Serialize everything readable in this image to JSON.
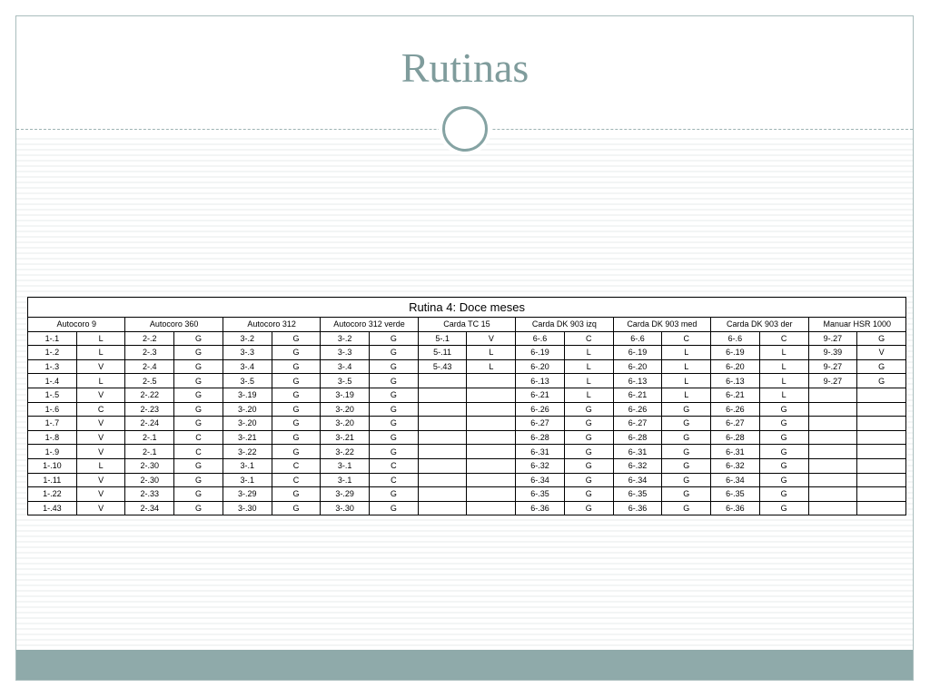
{
  "slide": {
    "title": "Rutinas"
  },
  "table": {
    "caption": "Rutina 4: Doce meses",
    "groups": [
      "Autocoro 9",
      "Autocoro 360",
      "Autocoro 312",
      "Autocoro 312 verde",
      "Carda TC 15",
      "Carda DK 903 izq",
      "Carda DK 903 med",
      "Carda DK 903 der",
      "Manuar HSR 1000"
    ],
    "rows": [
      [
        "1-.1",
        "L",
        "2-.2",
        "G",
        "3-.2",
        "G",
        "3-.2",
        "G",
        "5-.1",
        "V",
        "6-.6",
        "C",
        "6-.6",
        "C",
        "6-.6",
        "C",
        "9-.27",
        "G"
      ],
      [
        "1-.2",
        "L",
        "2-.3",
        "G",
        "3-.3",
        "G",
        "3-.3",
        "G",
        "5-.11",
        "L",
        "6-.19",
        "L",
        "6-.19",
        "L",
        "6-.19",
        "L",
        "9-.39",
        "V"
      ],
      [
        "1-.3",
        "V",
        "2-.4",
        "G",
        "3-.4",
        "G",
        "3-.4",
        "G",
        "5-.43",
        "L",
        "6-.20",
        "L",
        "6-.20",
        "L",
        "6-.20",
        "L",
        "9-.27",
        "G"
      ],
      [
        "1-.4",
        "L",
        "2-.5",
        "G",
        "3-.5",
        "G",
        "3-.5",
        "G",
        "",
        "",
        "6-.13",
        "L",
        "6-.13",
        "L",
        "6-.13",
        "L",
        "9-.27",
        "G"
      ],
      [
        "1-.5",
        "V",
        "2-.22",
        "G",
        "3-.19",
        "G",
        "3-.19",
        "G",
        "",
        "",
        "6-.21",
        "L",
        "6-.21",
        "L",
        "6-.21",
        "L",
        "",
        ""
      ],
      [
        "1-.6",
        "C",
        "2-.23",
        "G",
        "3-.20",
        "G",
        "3-.20",
        "G",
        "",
        "",
        "6-.26",
        "G",
        "6-.26",
        "G",
        "6-.26",
        "G",
        "",
        ""
      ],
      [
        "1-.7",
        "V",
        "2-.24",
        "G",
        "3-.20",
        "G",
        "3-.20",
        "G",
        "",
        "",
        "6-.27",
        "G",
        "6-.27",
        "G",
        "6-.27",
        "G",
        "",
        ""
      ],
      [
        "1-.8",
        "V",
        "2-.1",
        "C",
        "3-.21",
        "G",
        "3-.21",
        "G",
        "",
        "",
        "6-.28",
        "G",
        "6-.28",
        "G",
        "6-.28",
        "G",
        "",
        ""
      ],
      [
        "1-.9",
        "V",
        "2-.1",
        "C",
        "3-.22",
        "G",
        "3-.22",
        "G",
        "",
        "",
        "6-.31",
        "G",
        "6-.31",
        "G",
        "6-.31",
        "G",
        "",
        ""
      ],
      [
        "1-.10",
        "L",
        "2-.30",
        "G",
        "3-.1",
        "C",
        "3-.1",
        "C",
        "",
        "",
        "6-.32",
        "G",
        "6-.32",
        "G",
        "6-.32",
        "G",
        "",
        ""
      ],
      [
        "1-.11",
        "V",
        "2-.30",
        "G",
        "3-.1",
        "C",
        "3-.1",
        "C",
        "",
        "",
        "6-.34",
        "G",
        "6-.34",
        "G",
        "6-.34",
        "G",
        "",
        ""
      ],
      [
        "1-.22",
        "V",
        "2-.33",
        "G",
        "3-.29",
        "G",
        "3-.29",
        "G",
        "",
        "",
        "6-.35",
        "G",
        "6-.35",
        "G",
        "6-.35",
        "G",
        "",
        ""
      ],
      [
        "1-.43",
        "V",
        "2-.34",
        "G",
        "3-.30",
        "G",
        "3-.30",
        "G",
        "",
        "",
        "6-.36",
        "G",
        "6-.36",
        "G",
        "6-.36",
        "G",
        "",
        ""
      ]
    ]
  }
}
